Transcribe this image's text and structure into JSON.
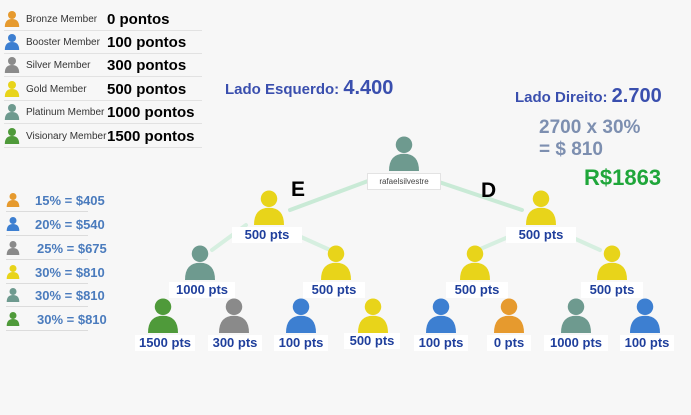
{
  "legend": [
    {
      "name": "Bronze Member",
      "points": "0 pontos",
      "color": "#e69a2e"
    },
    {
      "name": "Booster Member",
      "points": "100 pontos",
      "color": "#3d7fd1"
    },
    {
      "name": "Silver Member",
      "points": "300 pontos",
      "color": "#8a8a8a"
    },
    {
      "name": "Gold Member",
      "points": "500 pontos",
      "color": "#e8d41a"
    },
    {
      "name": "Platinum Member",
      "points": "1000 pontos",
      "color": "#6e9a8f"
    },
    {
      "name": "Visionary Member",
      "points": "1500 pontos",
      "color": "#4f9a3a"
    }
  ],
  "percentages": [
    {
      "text": "15% = $405",
      "color": "#e69a2e"
    },
    {
      "text": "20% = $540",
      "color": "#3d7fd1"
    },
    {
      "text": "25% = $675",
      "color": "#8a8a8a"
    },
    {
      "text": "30% = $810",
      "color": "#e8d41a"
    },
    {
      "text": "30% = $810",
      "color": "#6e9a8f"
    },
    {
      "text": "30% = $810",
      "color": "#4f9a3a"
    }
  ],
  "left_side": {
    "label": "Lado Esquerdo:",
    "value": "4.400"
  },
  "right_side": {
    "label": "Lado Direito:",
    "value": "2.700"
  },
  "calculation": {
    "line1": "2700 x 30%",
    "line2": "= $ 810"
  },
  "total": "R$1863",
  "branch_labels": {
    "left": "E",
    "right": "D"
  },
  "tree": {
    "root": {
      "name": "rafaelsilvestre",
      "color": "#6e9a8f"
    },
    "level1": [
      {
        "points": "500 pts",
        "color": "#e8d41a"
      },
      {
        "points": "500 pts",
        "color": "#e8d41a"
      }
    ],
    "level2": [
      {
        "points": "1000 pts",
        "color": "#6e9a8f"
      },
      {
        "points": "500 pts",
        "color": "#e8d41a"
      },
      {
        "points": "500 pts",
        "color": "#e8d41a"
      },
      {
        "points": "500 pts",
        "color": "#e8d41a"
      }
    ],
    "level3": [
      {
        "points": "1500 pts",
        "color": "#4f9a3a"
      },
      {
        "points": "300 pts",
        "color": "#8a8a8a"
      },
      {
        "points": "100 pts",
        "color": "#3d7fd1"
      },
      {
        "points": "500 pts",
        "color": "#e8d41a"
      },
      {
        "points": "100 pts",
        "color": "#3d7fd1"
      },
      {
        "points": "0 pts",
        "color": "#e69a2e"
      },
      {
        "points": "1000 pts",
        "color": "#6e9a8f"
      },
      {
        "points": "100 pts",
        "color": "#3d7fd1"
      }
    ]
  }
}
